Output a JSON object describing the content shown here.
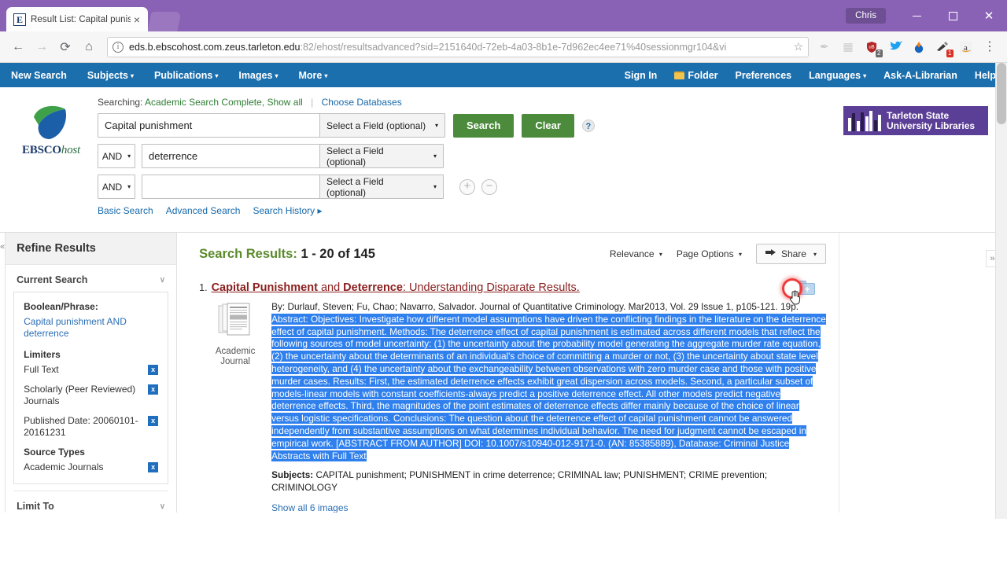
{
  "browser": {
    "tab": {
      "title": "Result List: Capital punish",
      "favicon_letter": "E",
      "close_label": "×"
    },
    "profile": "Chris",
    "nav": {
      "back": "←",
      "forward": "→",
      "reload": "⟳",
      "home": "⌂"
    },
    "url": {
      "host": "eds.b.ebscohost.com.zeus.tarleton.edu",
      "path": ":82/ehost/resultsadvanced?sid=2151640d-72eb-4a03-8b1e-7d962ec4ee71%40sessionmgr104&vi",
      "info_icon": "ⓘ",
      "star": "☆"
    },
    "extensions": [
      {
        "name": "pen-extension",
        "glyph": "✎",
        "badge": ""
      },
      {
        "name": "grey-extension",
        "glyph": "⬛",
        "badge": ""
      },
      {
        "name": "ublock-extension",
        "glyph": "⛨",
        "badge": "2"
      },
      {
        "name": "twitter-extension",
        "glyph": "🐦",
        "badge": ""
      },
      {
        "name": "download-extension",
        "glyph": "⬇",
        "badge": ""
      },
      {
        "name": "highlighter-extension",
        "glyph": "✒",
        "badge": "1"
      },
      {
        "name": "amazon-extension",
        "glyph": "a",
        "badge": ""
      }
    ],
    "menu": "⋮",
    "window_buttons": {
      "minimize": "minimize",
      "maximize": "maximize",
      "close": "✕"
    }
  },
  "topnav": {
    "left": [
      {
        "label": "New Search",
        "caret": false
      },
      {
        "label": "Subjects",
        "caret": true
      },
      {
        "label": "Publications",
        "caret": true
      },
      {
        "label": "Images",
        "caret": true
      },
      {
        "label": "More",
        "caret": true
      }
    ],
    "right": [
      {
        "label": "Sign In",
        "caret": false,
        "icon": ""
      },
      {
        "label": "Folder",
        "caret": false,
        "icon": "folder"
      },
      {
        "label": "Preferences",
        "caret": false,
        "icon": ""
      },
      {
        "label": "Languages",
        "caret": true,
        "icon": ""
      },
      {
        "label": "Ask-A-Librarian",
        "caret": false,
        "icon": ""
      },
      {
        "label": "Help",
        "caret": false,
        "icon": ""
      }
    ],
    "caret_glyph": "▾"
  },
  "brand": {
    "wordmark_bold": "EBSCO",
    "wordmark_italic": "host"
  },
  "library": {
    "line1": "Tarleton State",
    "line2": "University Libraries"
  },
  "search": {
    "searching_prefix": "Searching:",
    "database": "Academic Search Complete, Show all",
    "choose_databases": "Choose Databases",
    "rows": [
      {
        "bool": "",
        "value": "Capital punishment",
        "field": "Select a Field (optional)"
      },
      {
        "bool": "AND",
        "value": "deterrence",
        "field": "Select a Field (optional)"
      },
      {
        "bool": "AND",
        "value": "",
        "field": "Select a Field (optional)"
      }
    ],
    "search_button": "Search",
    "clear_button": "Clear",
    "help_glyph": "?",
    "add_row": "+",
    "remove_row": "−",
    "modes": [
      "Basic Search",
      "Advanced Search",
      "Search History ▸"
    ]
  },
  "sidebar": {
    "collapse_glyph": "«",
    "header": "Refine Results",
    "current_search": {
      "title": "Current Search",
      "chevron": "∨"
    },
    "boolean_label": "Boolean/Phrase:",
    "boolean_value": "Capital punishment AND deterrence",
    "limiters_label": "Limiters",
    "limiters": [
      {
        "label": "Full Text",
        "remove": "x"
      },
      {
        "label": "Scholarly (Peer Reviewed) Journals",
        "remove": "x"
      },
      {
        "label": "Published Date: 20060101-20161231",
        "remove": "x"
      }
    ],
    "source_types_label": "Source Types",
    "source_types": [
      {
        "label": "Academic Journals",
        "remove": "x"
      }
    ],
    "limit_to": {
      "title": "Limit To",
      "chevron": "∨"
    }
  },
  "results": {
    "heading_label": "Search Results:",
    "heading_range": "1 - 20 of 145",
    "sort": "Relevance",
    "page_options": "Page Options",
    "share": "Share",
    "caret_glyph": "▾",
    "item": {
      "number": "1.",
      "title_part1": "Capital Punishment",
      "title_and": " and ",
      "title_part2": "Deterrence",
      "title_rest": ": Understanding Disparate Results.",
      "thumb_label_line1": "Academic",
      "thumb_label_line2": "Journal",
      "citation": "By: Durlauf, Steven; Fu, Chao; Navarro, Salvador. Journal of Quantitative Criminology. Mar2013, Vol. 29 Issue 1, p105-121. 19p.",
      "abstract": "Abstract: Objectives: Investigate how different model assumptions have driven the conflicting findings in the literature on the deterrence effect of capital punishment. Methods: The deterrence effect of capital punishment is estimated across different models that reflect the following sources of model uncertainty: (1) the uncertainty about the probability model generating the aggregate murder rate equation, (2) the uncertainty about the determinants of an individual's choice of committing a murder or not, (3) the uncertainty about state level heterogeneity, and (4) the uncertainty about the exchangeability between observations with zero murder case and those with positive murder cases. Results: First, the estimated deterrence effects exhibit great dispersion across models. Second, a particular subset of models-linear models with constant coefficients-always predict a positive deterrence effect. All other models predict negative deterrence effects. Third, the magnitudes of the point estimates of deterrence effects differ mainly because of the choice of linear versus logistic specifications. Conclusions: The question about the deterrence effect of capital punishment cannot be answered independently from substantive assumptions on what determines individual behavior. The need for judgment cannot be escaped in empirical work. [ABSTRACT FROM AUTHOR] DOI: 10.1007/s10940-012-9171-0. (AN: 85385889), Database: Criminal Justice Abstracts with Full Text",
      "subjects_label": "Subjects:",
      "subjects": "CAPITAL punishment; PUNISHMENT in crime deterrence; CRIMINAL law; PUNISHMENT; CRIME prevention; CRIMINOLOGY",
      "show_images": "Show all 6 images",
      "add_to_folder": "+"
    }
  },
  "right_rail": {
    "expand_glyph": "»"
  }
}
